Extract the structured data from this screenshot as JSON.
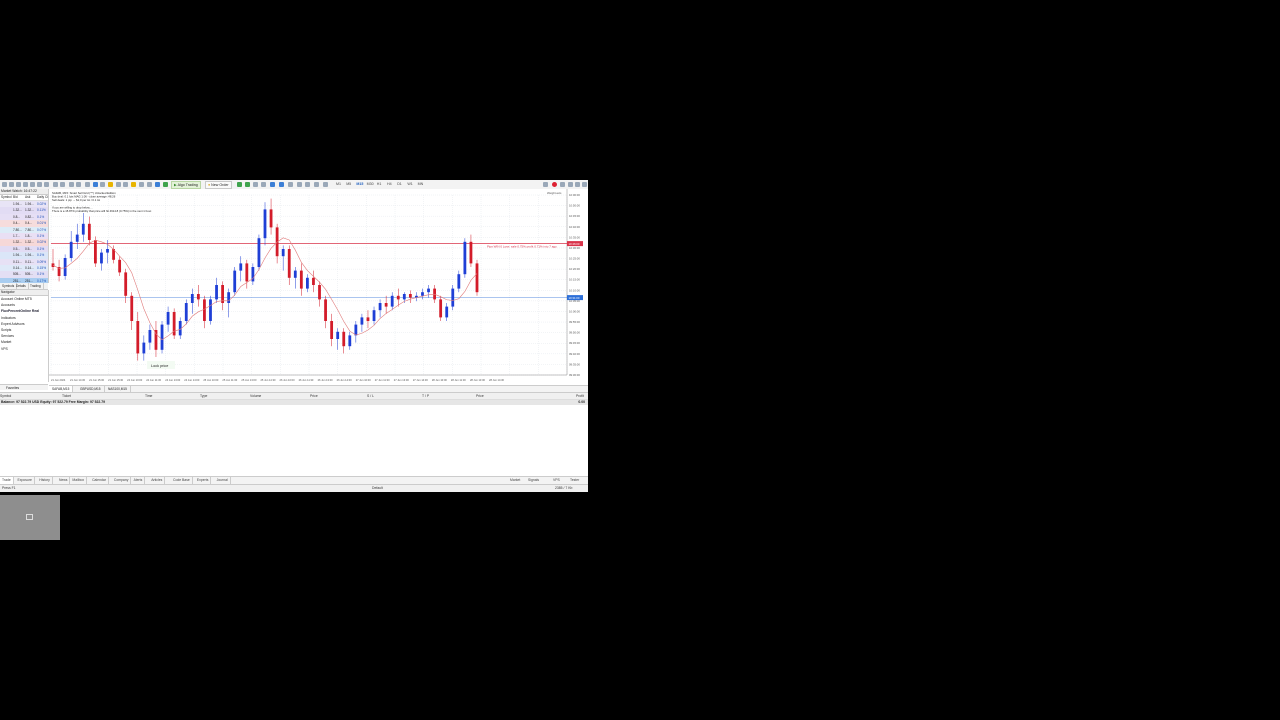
{
  "toolbar": {
    "algo_trading": "Algo Trading",
    "new_order": "New Order",
    "timeframes": [
      "M1",
      "M5",
      "M15",
      "M30",
      "H1",
      "H4",
      "D1",
      "W1",
      "MN"
    ],
    "active_timeframe": "M15"
  },
  "market_watch": {
    "title": "Market Watch: 16:47:22",
    "columns": [
      "Symbol",
      "Bid",
      "Ask",
      "Daily Ch."
    ],
    "rows": [
      [
        "",
        "1.94...",
        "1.94...",
        "0.02%"
      ],
      [
        "",
        "1.32...",
        "1.32...",
        "0.11%"
      ],
      [
        "",
        "0.8...",
        "0.82...",
        "0.1%"
      ],
      [
        "",
        "0.4...",
        "0.4...",
        "0.01%"
      ],
      [
        "",
        "7.80...",
        "7.80...",
        "0.07%"
      ],
      [
        "",
        "1.7...",
        "1.8...",
        "0.1%"
      ],
      [
        "",
        "1.32...",
        "1.32...",
        "0.02%"
      ],
      [
        "",
        "0.5...",
        "0.5...",
        "0.1%"
      ],
      [
        "",
        "1.94...",
        "1.94...",
        "0.1%"
      ],
      [
        "",
        "0.11...",
        "0.11...",
        "0.09%"
      ],
      [
        "",
        "0.14...",
        "0.14...",
        "0.15%"
      ],
      [
        "",
        "505...",
        "505...",
        "0.1%"
      ],
      [
        "",
        "251...",
        "251...",
        "0.17%"
      ],
      [
        "",
        "294...",
        "294...",
        "0.03%"
      ]
    ],
    "tabs": [
      "Symbols",
      "Details",
      "Trading"
    ]
  },
  "navigator": {
    "title": "Navigator",
    "items": [
      "Account Online MT5",
      "Accounts",
      "FluxPercentOnline Real",
      "Indicators",
      "Expert Advisors",
      "Scripts",
      "Services",
      "Market",
      "VPS"
    ],
    "bold_index": 2,
    "tab": "Favorites"
  },
  "chart": {
    "info_lines": [
      "SAFAB, M15: Smart Sell Grid (™) Unlocked Edition",
      "Buy deal: 0.1 lots MAG 1.06 - close average: 48.26",
      "Sell deals: 1 pip → $1.0 per lot / 0.1 lot",
      "",
      "If you are willing to drop below....",
      "There is a 15.87% probability that price will hit 4614.8 (0.75%) in the next 1 hour."
    ],
    "price_line_label": "Pips WIN 0 Lose: sale 0.75% profit 0.71% into 7 ago",
    "lock_price": "Lock price",
    "right_top_label": "Weight.axis",
    "tabs": [
      "SAFAB,M15",
      "GBPUSD,M15",
      "NAS100,M15"
    ],
    "active_tab": 0
  },
  "chart_data": {
    "type": "candlestick",
    "symbol": "SAFAB",
    "timeframe": "M15",
    "y_ticks": [
      "10:00:00",
      "10:50:00",
      "10:45:00",
      "10:40:00",
      "10:35:00",
      "10:30:00",
      "10:25:00",
      "10:20:00",
      "10:15:00",
      "10:10:00",
      "10:05:00",
      "10:00:00",
      "09:55:00",
      "09:50:00",
      "09:45:00",
      "09:40:00",
      "09:35:00",
      "09:30:00"
    ],
    "x_ticks": [
      "21 Jun 2024",
      "21 Jun 14:30",
      "21 Jun 15:00",
      "21 Jun 15:30",
      "24 Jun 10:00",
      "24 Jun 11:30",
      "24 Jun 13:00",
      "24 Jun 14:00",
      "25 Jun 10:00",
      "25 Jun 11:30",
      "25 Jun 13:00",
      "25 Jun 14:30",
      "26 Jun 10:00",
      "26 Jun 11:30",
      "26 Jun 13:00",
      "26 Jun 14:00",
      "27 Jun 10:00",
      "27 Jun 11:30",
      "27 Jun 13:00",
      "27 Jun 14:30",
      "28 Jun 10:00",
      "28 Jun 11:30",
      "28 Jun 13:00",
      "28 Jun 14:30"
    ],
    "ylim": [
      0,
      100
    ],
    "red_line": 73,
    "blue_line": 43,
    "red_label": "10:46:00",
    "blue_label": "10:31:00",
    "candles": [
      [
        62,
        70,
        58,
        60
      ],
      [
        60,
        64,
        52,
        55
      ],
      [
        55,
        67,
        53,
        65
      ],
      [
        65,
        80,
        63,
        74
      ],
      [
        74,
        84,
        70,
        78
      ],
      [
        78,
        90,
        74,
        84
      ],
      [
        84,
        88,
        72,
        75
      ],
      [
        75,
        77,
        60,
        62
      ],
      [
        62,
        70,
        58,
        68
      ],
      [
        68,
        75,
        62,
        70
      ],
      [
        70,
        72,
        62,
        64
      ],
      [
        64,
        66,
        55,
        57
      ],
      [
        57,
        59,
        40,
        44
      ],
      [
        44,
        46,
        25,
        30
      ],
      [
        30,
        35,
        8,
        12
      ],
      [
        12,
        22,
        8,
        18
      ],
      [
        18,
        28,
        14,
        25
      ],
      [
        25,
        30,
        10,
        14
      ],
      [
        14,
        30,
        12,
        28
      ],
      [
        28,
        38,
        24,
        35
      ],
      [
        35,
        37,
        20,
        22
      ],
      [
        22,
        32,
        20,
        30
      ],
      [
        30,
        42,
        28,
        40
      ],
      [
        40,
        48,
        34,
        45
      ],
      [
        45,
        50,
        38,
        42
      ],
      [
        42,
        44,
        26,
        30
      ],
      [
        30,
        44,
        28,
        42
      ],
      [
        42,
        54,
        40,
        50
      ],
      [
        50,
        52,
        36,
        40
      ],
      [
        40,
        48,
        32,
        46
      ],
      [
        46,
        60,
        44,
        58
      ],
      [
        58,
        66,
        52,
        62
      ],
      [
        62,
        64,
        48,
        52
      ],
      [
        52,
        62,
        50,
        60
      ],
      [
        60,
        78,
        58,
        76
      ],
      [
        76,
        96,
        72,
        92
      ],
      [
        92,
        98,
        78,
        82
      ],
      [
        82,
        84,
        62,
        66
      ],
      [
        66,
        72,
        58,
        70
      ],
      [
        70,
        72,
        50,
        54
      ],
      [
        54,
        60,
        48,
        58
      ],
      [
        58,
        62,
        44,
        48
      ],
      [
        48,
        56,
        46,
        54
      ],
      [
        54,
        58,
        46,
        50
      ],
      [
        50,
        52,
        38,
        42
      ],
      [
        42,
        44,
        26,
        30
      ],
      [
        30,
        34,
        16,
        20
      ],
      [
        20,
        26,
        14,
        24
      ],
      [
        24,
        26,
        12,
        16
      ],
      [
        16,
        24,
        14,
        22
      ],
      [
        22,
        30,
        18,
        28
      ],
      [
        28,
        34,
        24,
        32
      ],
      [
        32,
        36,
        26,
        30
      ],
      [
        30,
        38,
        28,
        36
      ],
      [
        36,
        42,
        32,
        40
      ],
      [
        40,
        44,
        34,
        38
      ],
      [
        38,
        46,
        36,
        44
      ],
      [
        44,
        48,
        38,
        42
      ],
      [
        42,
        46,
        40,
        45
      ],
      [
        45,
        47,
        40,
        43
      ],
      [
        43,
        46,
        41,
        44
      ],
      [
        44,
        48,
        42,
        46
      ],
      [
        46,
        50,
        43,
        48
      ],
      [
        48,
        50,
        40,
        42
      ],
      [
        42,
        44,
        30,
        32
      ],
      [
        32,
        40,
        30,
        38
      ],
      [
        38,
        50,
        36,
        48
      ],
      [
        48,
        58,
        46,
        56
      ],
      [
        56,
        76,
        54,
        74
      ],
      [
        74,
        78,
        60,
        62
      ],
      [
        62,
        64,
        44,
        46
      ]
    ]
  },
  "toolbox": {
    "columns": [
      "Symbol",
      "Ticket",
      "Time",
      "Type",
      "Volume",
      "Price",
      "S / L",
      "T / P",
      "Price",
      "Profit"
    ],
    "balance_line": "Balance: 97 522.79 USD  Equity: 97 522.79  Free Margin: 97 522.79",
    "balance_profit": "0.00",
    "tabs": [
      "Trade",
      "Exposure",
      "History",
      "News",
      "Mailbox",
      "Calendar",
      "Company",
      "Alerts",
      "Articles",
      "Code Base",
      "Experts",
      "Journal"
    ],
    "active_tab": 0,
    "right_items": [
      "Market",
      "Signals",
      "VPS",
      "Tester"
    ]
  },
  "status": {
    "left": "Press F1",
    "center": "Default",
    "right": "2385 / 7 Kb"
  },
  "colors": {
    "bull": "#1f3fd6",
    "bear": "#d31c2a",
    "ma": "#e07b7b",
    "red_line": "#d9334a",
    "blue_line": "#2d6fd8",
    "grid": "#e4e8ee"
  }
}
